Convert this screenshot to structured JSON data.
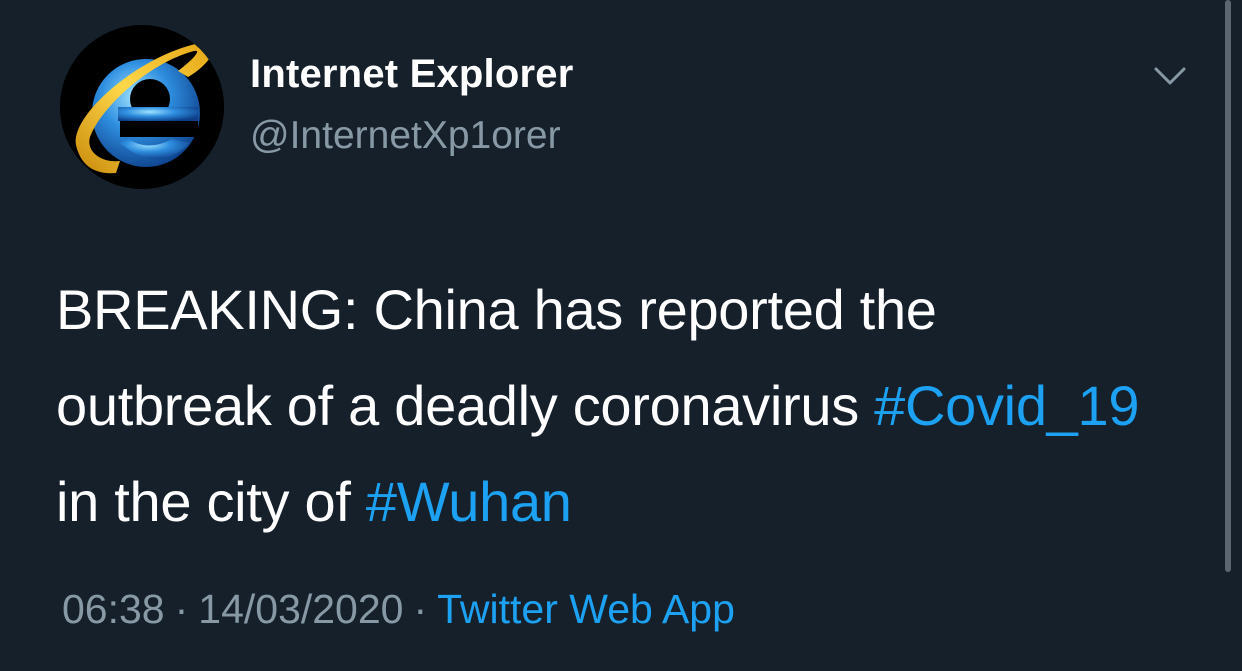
{
  "author": {
    "display_name": "Internet Explorer",
    "handle": "@InternetXp1orer",
    "avatar_icon": "internet-explorer-logo-icon"
  },
  "menu": {
    "icon": "chevron-down-icon"
  },
  "tweet": {
    "text_part1": "BREAKING: China has reported the outbreak of a deadly coronavirus ",
    "hashtag1": "#Covid_19",
    "text_part2": " in the city of ",
    "hashtag2": "#Wuhan"
  },
  "meta": {
    "time": "06:38",
    "separator": "·",
    "date": "14/03/2020",
    "source": "Twitter Web App"
  },
  "colors": {
    "background": "#15202b",
    "text": "#ffffff",
    "secondary_text": "#8899a6",
    "link": "#1da1f2"
  }
}
